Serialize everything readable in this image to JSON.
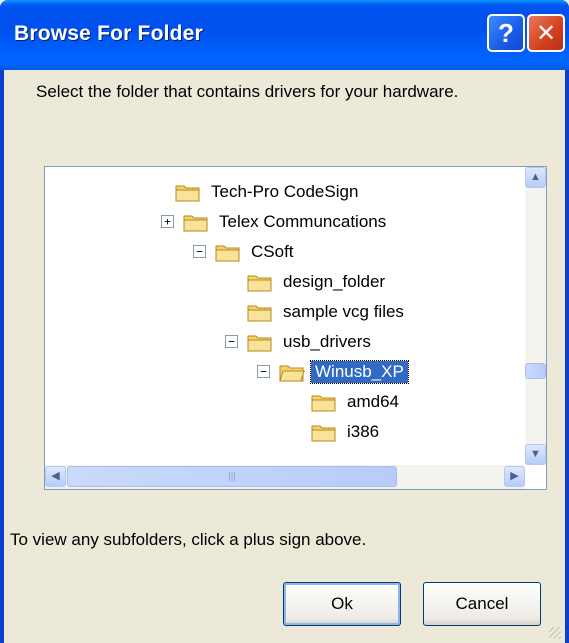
{
  "window": {
    "title": "Browse For Folder",
    "help_label": "?",
    "close_label": "✕"
  },
  "dialog": {
    "prompt": "Select the folder that contains drivers for your hardware.",
    "hint": "To view any subfolders, click a plus sign above.",
    "ok_label": "Ok",
    "cancel_label": "Cancel"
  },
  "tree": {
    "nodes": [
      {
        "label": "Tech-Pro CodeSign",
        "expander": ""
      },
      {
        "label": "Telex Communcations",
        "expander": "+"
      },
      {
        "label": "CSoft",
        "expander": "−"
      },
      {
        "label": "design_folder",
        "expander": ""
      },
      {
        "label": "sample vcg files",
        "expander": ""
      },
      {
        "label": "usb_drivers",
        "expander": "−"
      },
      {
        "label": "Winusb_XP",
        "expander": "−",
        "selected": true
      },
      {
        "label": "amd64",
        "expander": ""
      },
      {
        "label": "i386",
        "expander": ""
      }
    ]
  },
  "scrollbar": {
    "up": "▲",
    "down": "▼",
    "left": "◀",
    "right": "▶",
    "thumb_grip": "|||"
  },
  "colors": {
    "titlebar": "#0054E3",
    "selection": "#316AC5",
    "folder": "#F7D267"
  }
}
